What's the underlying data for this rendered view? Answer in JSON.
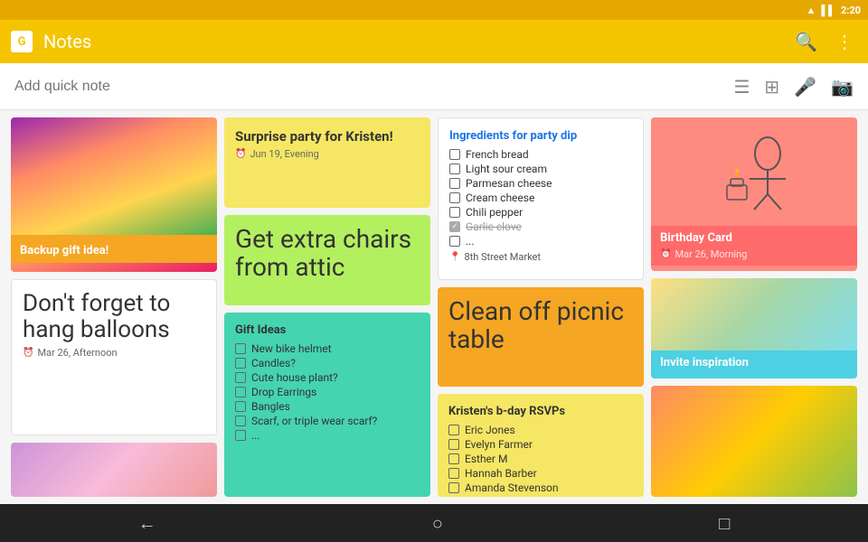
{
  "statusBar": {
    "time": "2:20",
    "wifiIcon": "wifi",
    "signalIcon": "signal",
    "batteryIcon": "battery"
  },
  "topBar": {
    "logoText": "G",
    "appTitle": "Notes",
    "searchIcon": "🔍",
    "moreIcon": "⋮"
  },
  "searchBar": {
    "placeholder": "Add quick note",
    "listIcon": "☰",
    "bulletIcon": "⊞",
    "micIcon": "🎤",
    "cameraIcon": "📷"
  },
  "notes": {
    "col1": [
      {
        "id": "flowers",
        "type": "image-label",
        "color": "flowers-bg",
        "imageLabel": "Backup gift idea!",
        "bodyText": "Don't forget to hang balloons",
        "date": "Mar 26, Afternoon"
      }
    ],
    "col2": [
      {
        "id": "surprise-party",
        "type": "text",
        "color": "note-yellow",
        "title": "Surprise party for Kristen!",
        "date": "Jun 19, Evening"
      },
      {
        "id": "get-chairs",
        "type": "large-text",
        "color": "note-green",
        "bodyText": "Get extra chairs from attic"
      },
      {
        "id": "gift-ideas",
        "type": "checklist",
        "color": "note-teal",
        "title": "Gift Ideas",
        "items": [
          {
            "text": "New bike helmet",
            "checked": false
          },
          {
            "text": "Candles?",
            "checked": false
          },
          {
            "text": "Cute house plant?",
            "checked": false
          },
          {
            "text": "Drop Earrings",
            "checked": false
          },
          {
            "text": "Bangles",
            "checked": false
          },
          {
            "text": "Scarf, or triple wear scarf?",
            "checked": false
          },
          {
            "text": "...",
            "checked": false
          }
        ]
      }
    ],
    "col3": [
      {
        "id": "ingredients",
        "type": "checklist",
        "color": "note-white",
        "title": "Ingredients for party dip",
        "items": [
          {
            "text": "French bread",
            "checked": false
          },
          {
            "text": "Light sour cream",
            "checked": false
          },
          {
            "text": "Parmesan cheese",
            "checked": false
          },
          {
            "text": "Cream cheese",
            "checked": false
          },
          {
            "text": "Chili pepper",
            "checked": false
          },
          {
            "text": "Garlic clove",
            "checked": true
          },
          {
            "text": "...",
            "checked": false
          }
        ],
        "location": "8th Street Market"
      },
      {
        "id": "clean-picnic",
        "type": "large-text",
        "color": "note-orange",
        "bodyText": "Clean off picnic table"
      },
      {
        "id": "rsvps",
        "type": "checklist",
        "color": "note-yellow",
        "title": "Kristen's b-day RSVPs",
        "items": [
          {
            "text": "Eric Jones",
            "checked": false
          },
          {
            "text": "Evelyn Farmer",
            "checked": false
          },
          {
            "text": "Esther M",
            "checked": false
          },
          {
            "text": "Hannah Barber",
            "checked": false
          },
          {
            "text": "Amanda Stevenson",
            "checked": false
          }
        ]
      }
    ],
    "col4": [
      {
        "id": "birthday-card",
        "type": "image-text",
        "color": "drawing-bg",
        "title": "Birthday Card",
        "date": "Mar 26, Morning"
      },
      {
        "id": "invite-inspiration",
        "type": "image-text",
        "color": "invite-bg",
        "title": "Invite inspiration"
      },
      {
        "id": "food",
        "type": "image-only",
        "color": "food-bg"
      }
    ]
  },
  "bottomNav": {
    "backIcon": "←",
    "homeIcon": "○",
    "recentIcon": "□"
  }
}
